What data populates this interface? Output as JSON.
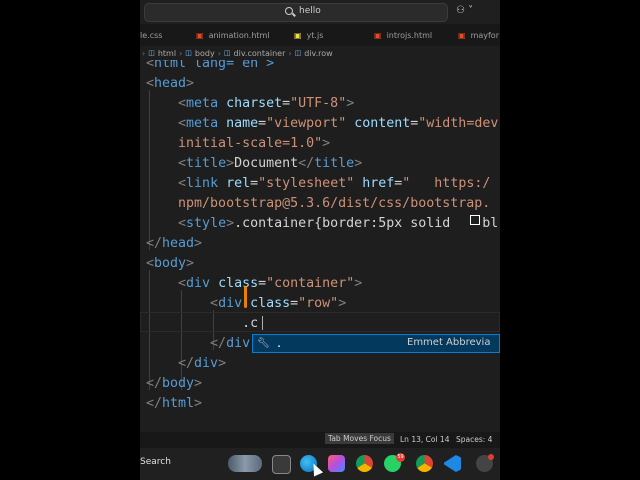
{
  "titlebar": {
    "search_text": "hello"
  },
  "tabs": [
    {
      "label": "le.css",
      "icon_color": "#42a5f5",
      "icon": "#"
    },
    {
      "label": "animation.html",
      "icon_color": "#e44d26",
      "icon": "5"
    },
    {
      "label": "yt.js",
      "icon_color": "#f0db4f",
      "icon": "JS"
    },
    {
      "label": "introjs.html",
      "icon_color": "#e44d26",
      "icon": "5"
    },
    {
      "label": "mayfor",
      "icon_color": "#e44d26",
      "icon": "5"
    }
  ],
  "breadcrumb": [
    "html",
    "body",
    "div.container",
    "div.row"
  ],
  "code": {
    "l0": "html lang= en >",
    "head_open": "head",
    "meta": "meta",
    "charset_attr": "charset",
    "charset_val": "\"UTF-8\"",
    "name_attr": "name",
    "viewport_val": "\"viewport\"",
    "content_attr": "content",
    "content_val": "\"width=dev",
    "content_cont": "initial-scale=1.0\"",
    "title": "title",
    "title_text": "Document",
    "link": "link",
    "rel_attr": "rel",
    "rel_val": "\"stylesheet\"",
    "href_attr": "href",
    "href_val": "\"   https:/",
    "href_cont": "npm/bootstrap@5.3.6/dist/css/bootstrap.",
    "style": "style",
    "style_text": ".container{border:5px solid ",
    "style_tail": "bl",
    "head_close": "head",
    "body_open": "body",
    "div": "div",
    "class_attr": "class",
    "container_val": "\"container\"",
    "row_val": "\"row\"",
    "typed": ".c",
    "body_close": "body",
    "html_close": "html"
  },
  "suggestion": {
    "label": ".",
    "detail": "Emmet Abbrevia"
  },
  "status": {
    "tab_focus": "Tab Moves Focus",
    "position": "Ln 13, Col 14",
    "spaces": "Spaces: 4"
  },
  "taskbar": {
    "search": "Search",
    "badge": "59"
  }
}
